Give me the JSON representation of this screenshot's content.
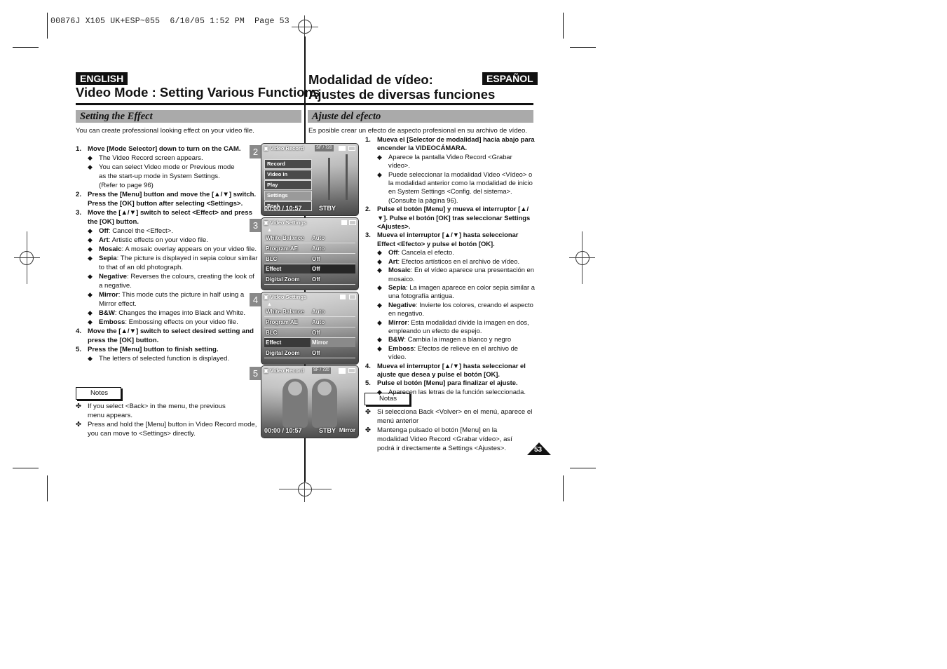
{
  "slug": "00876J X105 UK+ESP~055  6/10/05 1:52 PM  Page 53",
  "page_number": "53",
  "english": {
    "lang_label": "ENGLISH",
    "title": "Video Mode : Setting Various Functions",
    "section": "Setting the Effect",
    "intro": "You can create professional looking effect on your video file.",
    "steps": [
      {
        "num": "1.",
        "text": "Move [Mode Selector] down to turn on the CAM.",
        "bullets": [
          {
            "bold": "",
            "text": "The Video Record screen appears."
          },
          {
            "bold": "",
            "text": "You can select Video mode or Previous mode as the start-up mode in System Settings. (Refer to page 96)"
          }
        ]
      },
      {
        "num": "2.",
        "text": "Press the [Menu] button and move the [▲/▼] switch.",
        "text2": "Press the [OK] button after selecting <Settings>.",
        "bullets": []
      },
      {
        "num": "3.",
        "text": "Move the [▲/▼] switch to select <Effect> and press the [OK] button.",
        "bullets": [
          {
            "bold": "Off",
            "text": ": Cancel the <Effect>."
          },
          {
            "bold": "Art",
            "text": ": Artistic effects on your video file."
          },
          {
            "bold": "Mosaic",
            "text": ": A mosaic overlay appears on your video file."
          },
          {
            "bold": "Sepia",
            "text": ": The picture is displayed in sepia colour similar to that of an old photograph."
          },
          {
            "bold": "Negative",
            "text": ": Reverses the colours, creating the look of a negative."
          },
          {
            "bold": "Mirror",
            "text": ": This mode cuts the picture in half using a Mirror effect."
          },
          {
            "bold": "B&W",
            "text": ": Changes the images into Black and White."
          },
          {
            "bold": "Emboss",
            "text": ": Embossing effects on your video file."
          }
        ]
      },
      {
        "num": "4.",
        "text": "Move the [▲/▼] switch to select desired setting and press the [OK] button.",
        "bullets": []
      },
      {
        "num": "5.",
        "text": "Press the [Menu] button to finish setting.",
        "bullets": [
          {
            "bold": "",
            "text": "The letters of selected function is displayed."
          }
        ]
      }
    ],
    "notes_label": "Notes",
    "notes": [
      "If you select <Back> in the menu, the previous menu appears.",
      "Press and hold the [Menu] button in Video Record mode, you can move to <Settings> directly."
    ]
  },
  "spanish": {
    "lang_label": "ESPAÑOL",
    "title_line1": "Modalidad de vídeo:",
    "title_line2": "Ajustes de diversas funciones",
    "section": "Ajuste del efecto",
    "intro": "Es posible crear un efecto de aspecto profesional en su archivo de vídeo.",
    "steps": [
      {
        "num": "1.",
        "text": "Mueva el [Selector de modalidad] hacia abajo para encender la VIDEOCÁMARA.",
        "bullets": [
          {
            "bold": "",
            "text": "Aparece la pantalla Video Record <Grabar vídeo>."
          },
          {
            "bold": "",
            "text": "Puede seleccionar la modalidad Video <Vídeo> o la modalidad anterior como la modalidad de inicio en System Settings <Config. del sistema>. (Consulte la página 96)."
          }
        ]
      },
      {
        "num": "2.",
        "text": "Pulse el botón [Menu] y mueva el interruptor [▲/▼]. Pulse el botón [OK] tras seleccionar Settings <Ajustes>.",
        "bullets": []
      },
      {
        "num": "3.",
        "text": "Mueva el interruptor [▲/▼] hasta seleccionar Effect <Efecto> y pulse el botón [OK].",
        "bullets": [
          {
            "bold": "Off",
            "text": ": Cancela el efecto."
          },
          {
            "bold": "Art",
            "text": ": Efectos artísticos en el archivo de vídeo."
          },
          {
            "bold": "Mosaic",
            "text": ": En el vídeo aparece una presentación en mosaico."
          },
          {
            "bold": "Sepia",
            "text": ": La imagen aparece en color sepia similar a una fotografía antigua."
          },
          {
            "bold": "Negative",
            "text": ": Invierte los colores, creando el aspecto en negativo."
          },
          {
            "bold": "Mirror",
            "text": ": Esta modalidad divide la imagen en dos, empleando un efecto de espejo."
          },
          {
            "bold": "B&W",
            "text": ": Cambia la imagen a blanco y negro"
          },
          {
            "bold": "Emboss",
            "text": ": Efectos de relieve en el archivo de vídeo."
          }
        ]
      },
      {
        "num": "4.",
        "text": "Mueva el interruptor [▲/▼] hasta seleccionar el ajuste que desea y pulse el botón [OK].",
        "bullets": []
      },
      {
        "num": "5.",
        "text": "Pulse el botón [Menu] para finalizar el ajuste.",
        "bullets": [
          {
            "bold": "",
            "text": "Aparecen las letras de la función seleccionada."
          }
        ]
      }
    ],
    "notes_label": "Notas",
    "notes": [
      "Si selecciona Back <Volver> en el menú, aparece el menú anterior",
      "Mantenga pulsado el botón [Menu] en la modalidad Video Record <Grabar vídeo>, así podrá ir directamente a Settings <Ajustes>."
    ]
  },
  "screens": [
    {
      "num": "2",
      "header": "Video Record",
      "badges": [
        "SF",
        "/",
        "720"
      ],
      "menu": [
        "Record",
        "Video In",
        "Play",
        "Settings",
        "Back"
      ],
      "menu_selected": "Settings",
      "status": "00:00 / 10:57",
      "status_mode": "STBY"
    },
    {
      "num": "3",
      "header": "Video Settings",
      "rows": [
        {
          "label": "White Balance",
          "value": "Auto"
        },
        {
          "label": "Program AE",
          "value": "Auto"
        },
        {
          "label": "BLC",
          "value": "Off"
        },
        {
          "label": "Effect",
          "value": "Off",
          "selected": true
        },
        {
          "label": "Digital Zoom",
          "value": "Off"
        }
      ]
    },
    {
      "num": "4",
      "header": "Video Settings",
      "rows": [
        {
          "label": "White Balance",
          "value": "Auto"
        },
        {
          "label": "Program AE",
          "value": "Auto"
        },
        {
          "label": "BLC",
          "value": "Off"
        },
        {
          "label": "Effect",
          "value": "Mirror",
          "selected": true
        },
        {
          "label": "Digital Zoom",
          "value": "Off"
        }
      ]
    },
    {
      "num": "5",
      "header": "Video Record",
      "badges": [
        "SF",
        "/",
        "720"
      ],
      "status": "00:00 / 10:57",
      "status_mode": "STBY",
      "effect_label": "Mirror"
    }
  ],
  "symbols": {
    "bullet": "◆",
    "note": "✤",
    "camera_icon": "🎥"
  }
}
